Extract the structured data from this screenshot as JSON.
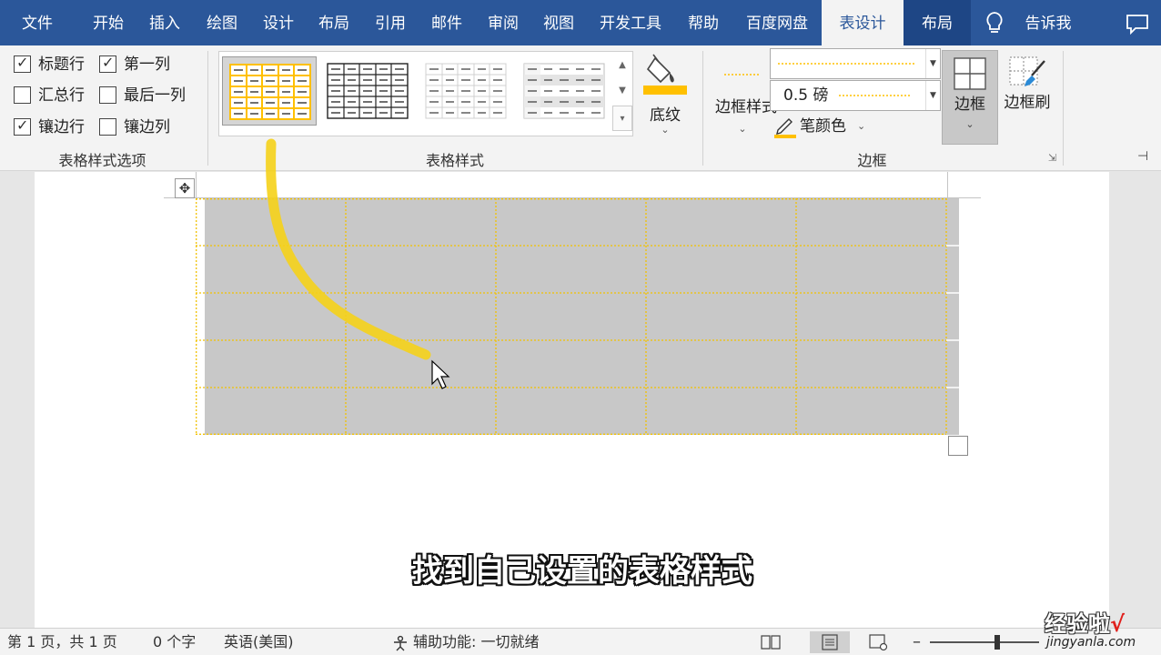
{
  "tabs": [
    {
      "label": "文件",
      "active": false
    },
    {
      "label": "开始",
      "active": false
    },
    {
      "label": "插入",
      "active": false
    },
    {
      "label": "绘图",
      "active": false
    },
    {
      "label": "设计",
      "active": false
    },
    {
      "label": "布局",
      "active": false
    },
    {
      "label": "引用",
      "active": false
    },
    {
      "label": "邮件",
      "active": false
    },
    {
      "label": "审阅",
      "active": false
    },
    {
      "label": "视图",
      "active": false
    },
    {
      "label": "开发工具",
      "active": false
    },
    {
      "label": "帮助",
      "active": false
    },
    {
      "label": "百度网盘",
      "active": false
    },
    {
      "label": "表设计",
      "active": true
    },
    {
      "label": "布局",
      "active": false
    }
  ],
  "tell_me": "告诉我",
  "style_options": {
    "group_label": "表格样式选项",
    "items": [
      {
        "label": "标题行",
        "checked": true
      },
      {
        "label": "第一列",
        "checked": true
      },
      {
        "label": "汇总行",
        "checked": false
      },
      {
        "label": "最后一列",
        "checked": false
      },
      {
        "label": "镶边行",
        "checked": true
      },
      {
        "label": "镶边列",
        "checked": false
      }
    ]
  },
  "table_styles": {
    "group_label": "表格样式",
    "shading_label": "底纹",
    "shading_color": "#ffc000"
  },
  "borders": {
    "group_label": "边框",
    "border_styles_label": "边框样式",
    "weight_value": "0.5 磅",
    "pen_color_label": "笔颜色",
    "borders_label": "边框",
    "painter_label": "边框刷",
    "line_color": "#ffc000"
  },
  "document": {
    "rows": 5,
    "cols": 5,
    "cell_fill": "#c8c8c8",
    "border_color": "#f2c200",
    "subtitle": "找到自己设置的表格样式"
  },
  "status": {
    "page": "第 1 页，共 1 页",
    "words": "0 个字",
    "language": "英语(美国)",
    "accessibility": "辅助功能: 一切就绪"
  },
  "watermark": {
    "line1": "经验啦",
    "check": "√",
    "line2": "jingyanla.com"
  }
}
